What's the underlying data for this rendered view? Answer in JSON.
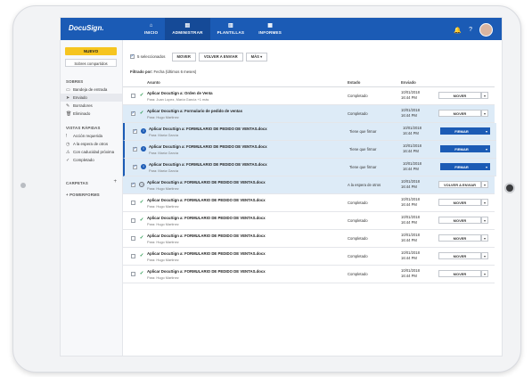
{
  "header": {
    "logo": "DocuSign.",
    "nav": [
      {
        "icon": "⌂",
        "label": "INICIO"
      },
      {
        "icon": "▤",
        "label": "ADMINISTRAR"
      },
      {
        "icon": "▥",
        "label": "PLANTILLAS"
      },
      {
        "icon": "▦",
        "label": "INFORMES"
      }
    ],
    "bell": "🔔",
    "help": "?"
  },
  "sidebar": {
    "new_button": "NUEVO",
    "shared_button": "Sobres compartidos",
    "envelopes_title": "SOBRES",
    "envelopes": [
      {
        "icon": "▭",
        "label": "Bandeja de entrada"
      },
      {
        "icon": "➤",
        "label": "Enviado"
      },
      {
        "icon": "✎",
        "label": "Borradores"
      },
      {
        "icon": "🗑",
        "label": "Eliminado"
      }
    ],
    "quick_title": "VISTAS RÁPIDAS",
    "quick_views": [
      {
        "icon": "!",
        "label": "Acción requerida"
      },
      {
        "icon": "◷",
        "label": "A la espera de otros"
      },
      {
        "icon": "⚠",
        "label": "Con caducidad próxima"
      },
      {
        "icon": "✓",
        "label": "Completado"
      }
    ],
    "folders_title": "CARPETAS",
    "folders_plus": "+",
    "powerforms": "+ POWERFORMS"
  },
  "toolbar": {
    "selected": "5 seleccionados",
    "move": "MOVER",
    "resend": "VOLVER A ENVIAR",
    "more": "MÁS ▾"
  },
  "filter": {
    "label": "Filtrado por:",
    "value": "Fecha (Últimos 6 meses)"
  },
  "table": {
    "headers": {
      "subject": "Asunto",
      "status": "Estado",
      "sent": "Enviado"
    },
    "rows": [
      {
        "subject": "Aplicar DocuSign a: Orden de Venta",
        "to": "Para: Juan Lopez, María García +1 más",
        "status": "Completado",
        "date": "10/01/2018",
        "time": "16:44 PM",
        "action": "MOVER"
      },
      {
        "subject": "Aplicar DocuSign a: Formulario de pedido de ventas",
        "to": "Para: Hugo Martinez",
        "status": "Completado",
        "date": "10/01/2018",
        "time": "16:44 PM",
        "action": "MOVER"
      },
      {
        "subject": "Aplicar DocuSign a: FORMULARIO DE PEDIDO DE VENTAS.docx",
        "to": "Para: María García",
        "status": "Tiene que firmar",
        "date": "10/01/2018",
        "time": "16:44 PM",
        "action": "FIRMAR"
      },
      {
        "subject": "Aplicar DocuSign a: FORMULARIO DE PEDIDO DE VENTAS.docx",
        "to": "Para: María García",
        "status": "Tiene que firmar",
        "date": "10/01/2018",
        "time": "16:44 PM",
        "action": "FIRMAR"
      },
      {
        "subject": "Aplicar DocuSign a: FORMULARIO DE PEDIDO DE VENTAS.docx",
        "to": "Para: María García",
        "status": "Tiene que firmar",
        "date": "10/01/2018",
        "time": "16:44 PM",
        "action": "FIRMAR"
      },
      {
        "subject": "Aplicar DocuSign a: FORMULARIO DE PEDIDO DE VENTAS.docx",
        "to": "Para: Hugo Martinez",
        "status": "A la espera de otros",
        "date": "10/01/2018",
        "time": "16:44 PM",
        "action": "VOLVER A ENVIAR"
      },
      {
        "subject": "Aplicar DocuSign a: FORMULARIO DE PEDIDO DE VENTAS.docx",
        "to": "Para: Hugo Martinez",
        "status": "Completado",
        "date": "10/01/2018",
        "time": "16:44 PM",
        "action": "MOVER"
      },
      {
        "subject": "Aplicar DocuSign a: FORMULARIO DE PEDIDO DE VENTAS.docx",
        "to": "Para: Hugo Martinez",
        "status": "Completado",
        "date": "10/01/2018",
        "time": "16:44 PM",
        "action": "MOVER"
      },
      {
        "subject": "Aplicar DocuSign a: FORMULARIO DE PEDIDO DE VENTAS.docx",
        "to": "Para: Hugo Martinez",
        "status": "Completado",
        "date": "10/01/2018",
        "time": "16:44 PM",
        "action": "MOVER"
      },
      {
        "subject": "Aplicar DocuSign a: FORMULARIO DE PEDIDO DE VENTAS.docx",
        "to": "Para: Hugo Martinez",
        "status": "Completado",
        "date": "10/01/2018",
        "time": "16:44 PM",
        "action": "MOVER"
      },
      {
        "subject": "Aplicar DocuSign a: FORMULARIO DE PEDIDO DE VENTAS.docx",
        "to": "Para: Hugo Martinez",
        "status": "Completado",
        "date": "10/01/2018",
        "time": "16:44 PM",
        "action": "MOVER"
      }
    ]
  },
  "colors": {
    "brand": "#1b5bb5",
    "accent_yellow": "#f6c520",
    "highlight_row": "#ddebf7",
    "completed_check": "#2c9b52"
  }
}
